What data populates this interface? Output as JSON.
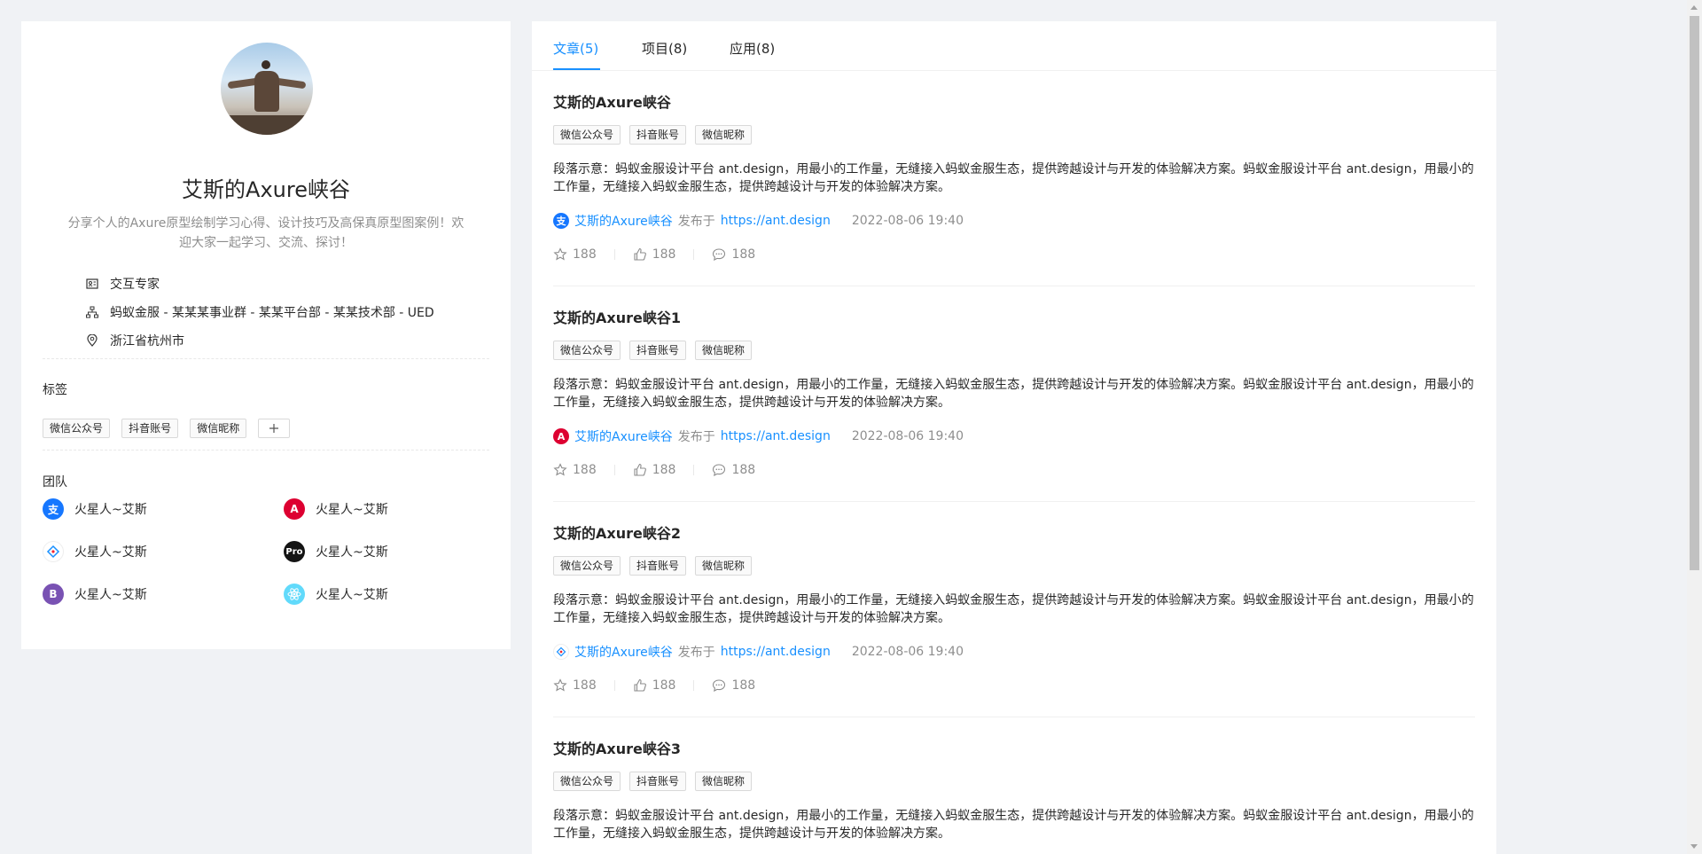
{
  "profile": {
    "name": "艾斯的Axure峡谷",
    "description": "分享个人的Axure原型绘制学习心得、设计技巧及高保真原型图案例！欢迎大家一起学习、交流、探讨！",
    "title": "交互专家",
    "department": "蚂蚁金服 - 某某某事业群 - 某某平台部 - 某某技术部 - UED",
    "location": "浙江省杭州市"
  },
  "tags_section": {
    "title": "标签",
    "tags": [
      "微信公众号",
      "抖音账号",
      "微信昵称"
    ],
    "add_label": "+"
  },
  "team": {
    "title": "团队",
    "members": [
      {
        "name": "火星人~艾斯",
        "icon": "alipay-icon",
        "color": "#1677ff",
        "glyph": "支"
      },
      {
        "name": "火星人~艾斯",
        "icon": "angular-icon",
        "color": "#dd0031",
        "glyph": "A"
      },
      {
        "name": "火星人~艾斯",
        "icon": "ant-design-icon",
        "color": "#ffffff",
        "glyph": "◇"
      },
      {
        "name": "火星人~艾斯",
        "icon": "pro-icon",
        "color": "#141414",
        "glyph": "Pro"
      },
      {
        "name": "火星人~艾斯",
        "icon": "bootstrap-icon",
        "color": "#7952b3",
        "glyph": "B"
      },
      {
        "name": "火星人~艾斯",
        "icon": "react-icon",
        "color": "#61dafb",
        "glyph": "⚛"
      }
    ]
  },
  "tabs": [
    {
      "label": "文章(5)",
      "active": true
    },
    {
      "label": "项目(8)",
      "active": false
    },
    {
      "label": "应用(8)",
      "active": false
    }
  ],
  "articles": [
    {
      "title": "艾斯的Axure峡谷",
      "tags": [
        "微信公众号",
        "抖音账号",
        "微信昵称"
      ],
      "content": "段落示意：蚂蚁金服设计平台 ant.design，用最小的工作量，无缝接入蚂蚁金服生态，提供跨越设计与开发的体验解决方案。蚂蚁金服设计平台 ant.design，用最小的工作量，无缝接入蚂蚁金服生态，提供跨越设计与开发的体验解决方案。",
      "author": "艾斯的Axure峡谷",
      "author_icon": "alipay-icon",
      "published_label": "发布于",
      "link": "https://ant.design",
      "time": "2022-08-06 19:40",
      "stars": "188",
      "likes": "188",
      "comments": "188"
    },
    {
      "title": "艾斯的Axure峡谷1",
      "tags": [
        "微信公众号",
        "抖音账号",
        "微信昵称"
      ],
      "content": "段落示意：蚂蚁金服设计平台 ant.design，用最小的工作量，无缝接入蚂蚁金服生态，提供跨越设计与开发的体验解决方案。蚂蚁金服设计平台 ant.design，用最小的工作量，无缝接入蚂蚁金服生态，提供跨越设计与开发的体验解决方案。",
      "author": "艾斯的Axure峡谷",
      "author_icon": "angular-icon",
      "published_label": "发布于",
      "link": "https://ant.design",
      "time": "2022-08-06 19:40",
      "stars": "188",
      "likes": "188",
      "comments": "188"
    },
    {
      "title": "艾斯的Axure峡谷2",
      "tags": [
        "微信公众号",
        "抖音账号",
        "微信昵称"
      ],
      "content": "段落示意：蚂蚁金服设计平台 ant.design，用最小的工作量，无缝接入蚂蚁金服生态，提供跨越设计与开发的体验解决方案。蚂蚁金服设计平台 ant.design，用最小的工作量，无缝接入蚂蚁金服生态，提供跨越设计与开发的体验解决方案。",
      "author": "艾斯的Axure峡谷",
      "author_icon": "ant-design-icon",
      "published_label": "发布于",
      "link": "https://ant.design",
      "time": "2022-08-06 19:40",
      "stars": "188",
      "likes": "188",
      "comments": "188"
    },
    {
      "title": "艾斯的Axure峡谷3",
      "tags": [
        "微信公众号",
        "抖音账号",
        "微信昵称"
      ],
      "content": "段落示意：蚂蚁金服设计平台 ant.design，用最小的工作量，无缝接入蚂蚁金服生态，提供跨越设计与开发的体验解决方案。蚂蚁金服设计平台 ant.design，用最小的工作量，无缝接入蚂蚁金服生态，提供跨越设计与开发的体验解决方案。"
    }
  ],
  "colors": {
    "primary": "#1890ff",
    "background": "#f0f2f5"
  }
}
